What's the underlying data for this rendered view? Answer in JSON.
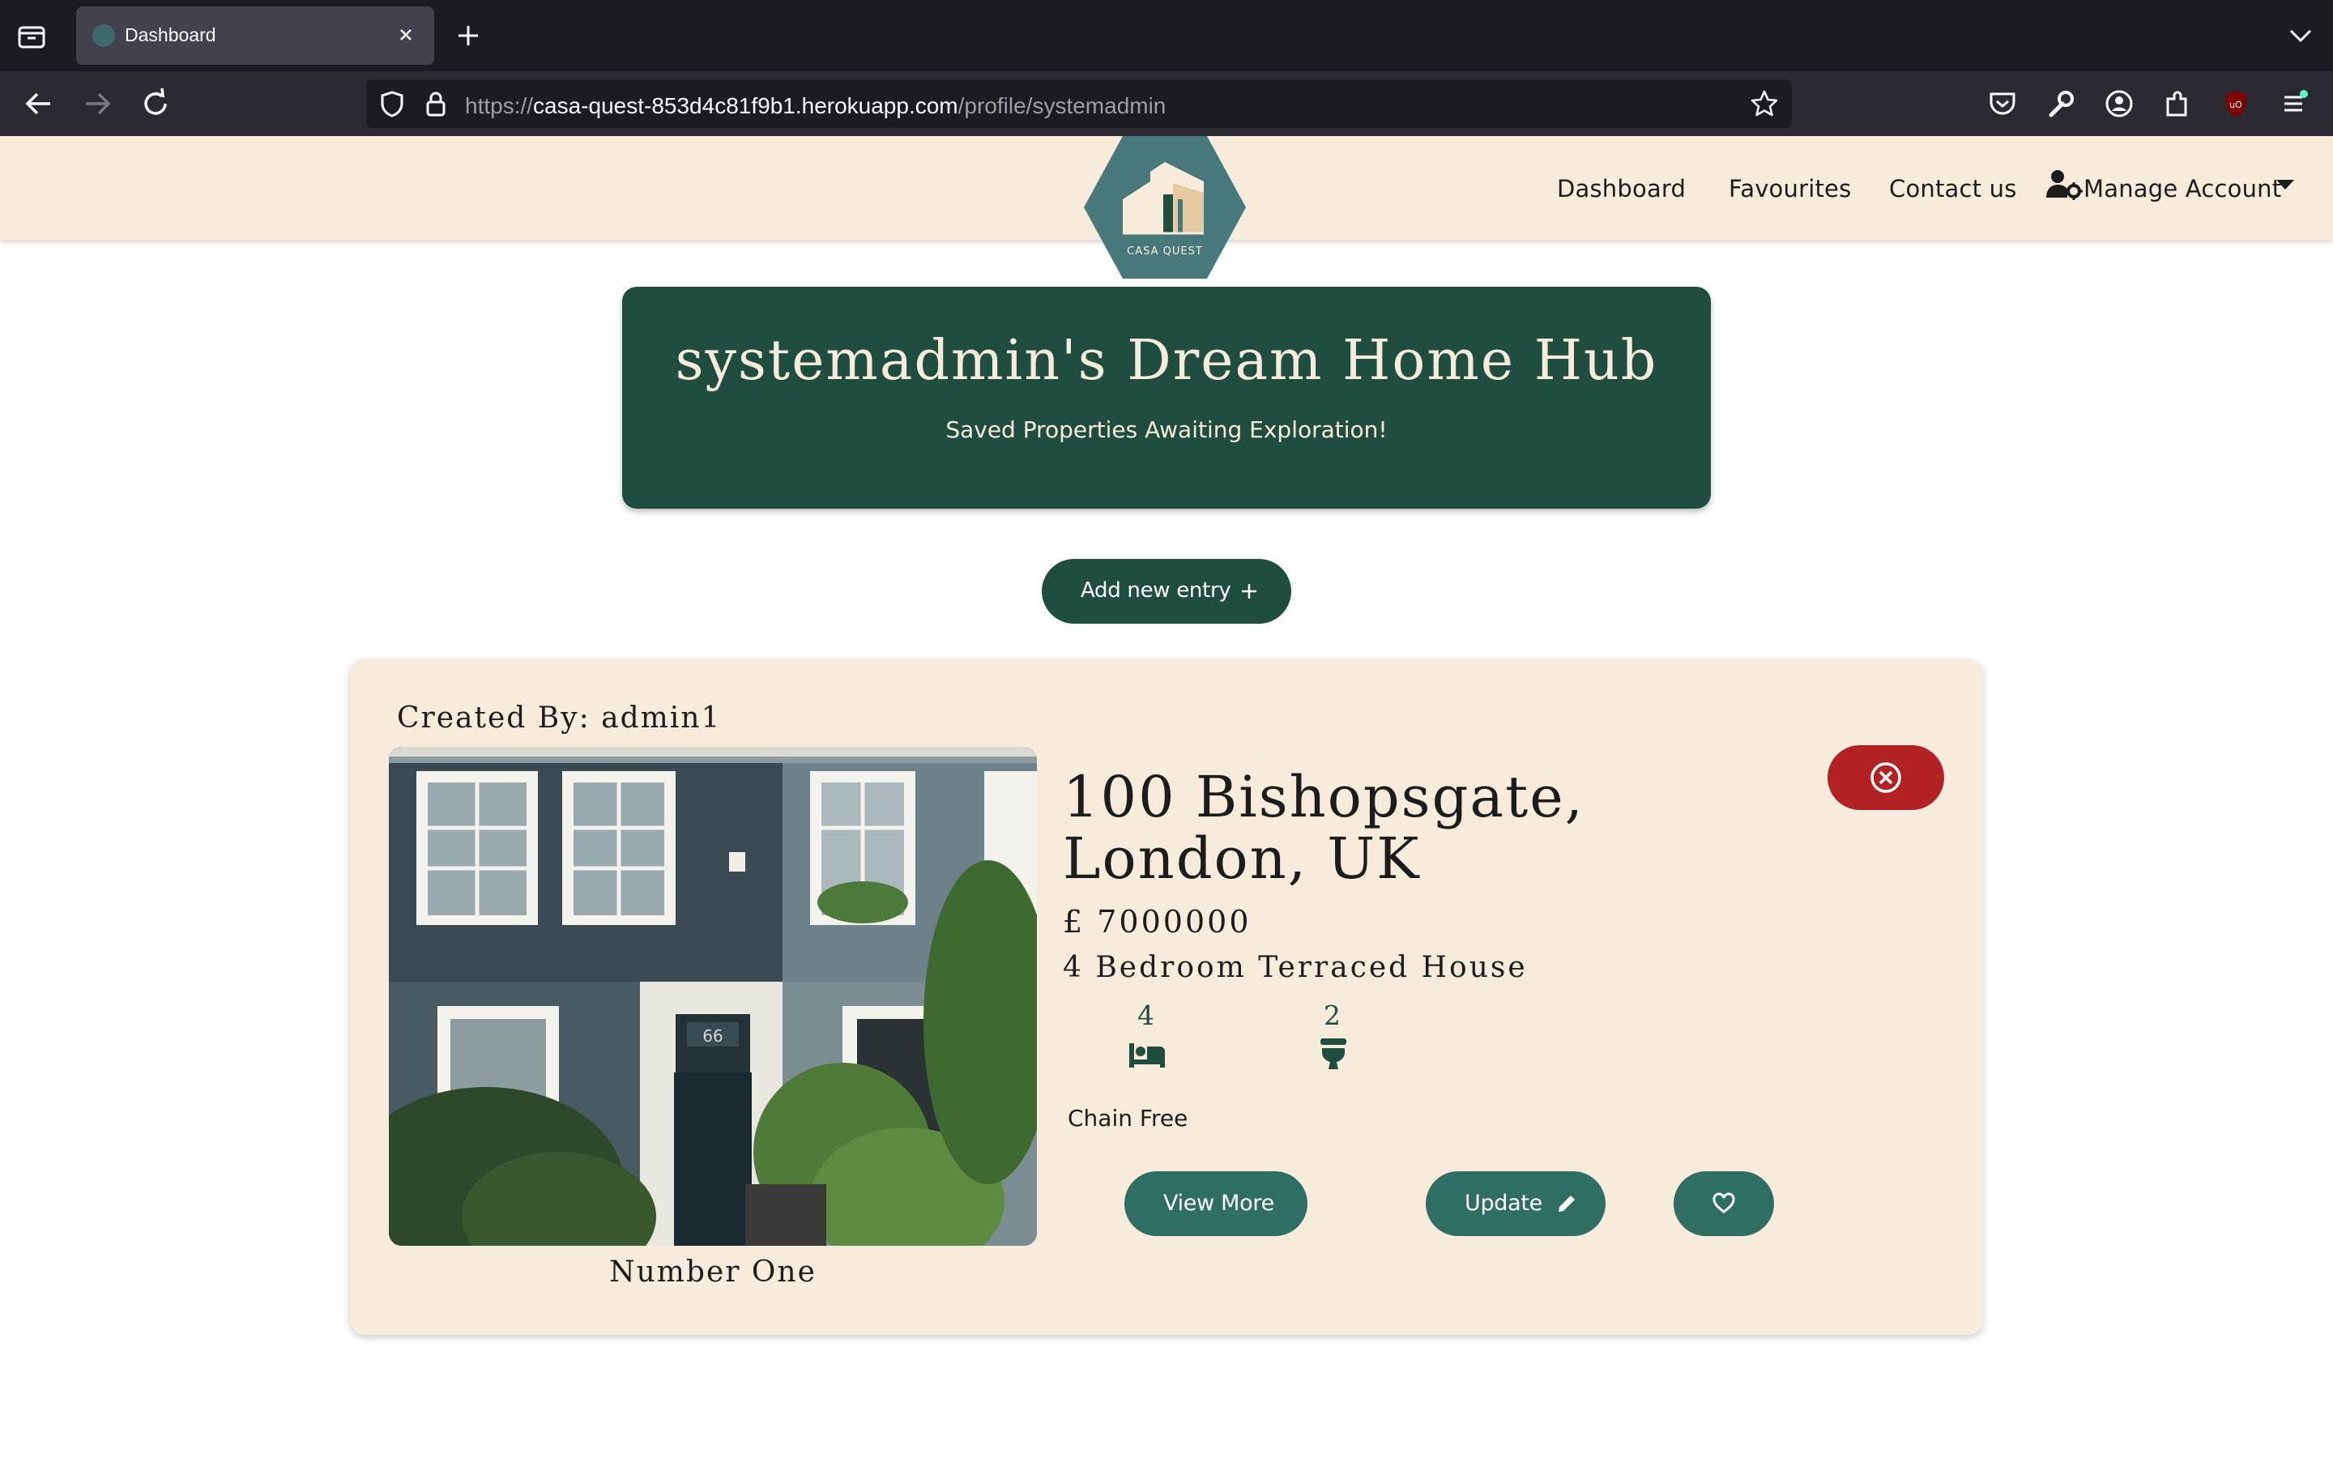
{
  "browser": {
    "tab_title": "Dashboard",
    "url_prefix": "https://",
    "url_host": "casa-quest-853d4c81f9b1.herokuapp.com",
    "url_path": "/profile/systemadmin"
  },
  "site": {
    "logo_text": "CASA QUEST",
    "nav": {
      "dashboard": "Dashboard",
      "favourites": "Favourites",
      "contact": "Contact us",
      "manage_account": "Manage Account"
    }
  },
  "hero": {
    "title": "systemadmin's Dream Home Hub",
    "subtitle": "Saved Properties Awaiting Exploration!"
  },
  "add_entry": {
    "label": "Add new entry"
  },
  "card": {
    "created_by": "Created By: admin1",
    "photo_caption": "Number One",
    "address": "100 Bishopsgate, London, UK",
    "price": "£ 7000000",
    "property_type": "4 Bedroom Terraced House",
    "bedrooms": "4",
    "bathrooms": "2",
    "chain_status": "Chain Free",
    "buttons": {
      "view_more": "View More",
      "update": "Update"
    }
  },
  "colors": {
    "brand_green": "#1f4d40",
    "button_teal": "#2f6e62",
    "cream": "#f7ebdc",
    "danger_red": "#b22222"
  }
}
